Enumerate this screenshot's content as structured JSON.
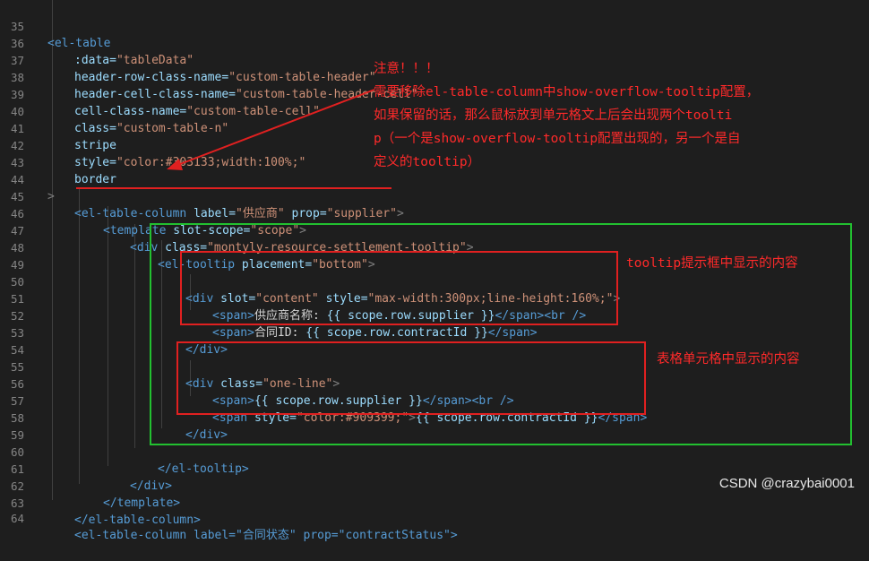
{
  "lines": [
    {
      "n": "35"
    },
    {
      "n": "36"
    },
    {
      "n": "37"
    },
    {
      "n": "38"
    },
    {
      "n": "39"
    },
    {
      "n": "40"
    },
    {
      "n": "41"
    },
    {
      "n": "42"
    },
    {
      "n": "43"
    },
    {
      "n": "44"
    },
    {
      "n": "45"
    },
    {
      "n": "46"
    },
    {
      "n": "47"
    },
    {
      "n": "48"
    },
    {
      "n": "49"
    },
    {
      "n": "50"
    },
    {
      "n": "51"
    },
    {
      "n": "52"
    },
    {
      "n": "53"
    },
    {
      "n": "54"
    },
    {
      "n": "55"
    },
    {
      "n": "56"
    },
    {
      "n": "57"
    },
    {
      "n": "58"
    },
    {
      "n": "59"
    },
    {
      "n": "60"
    },
    {
      "n": "61"
    },
    {
      "n": "62"
    },
    {
      "n": "63"
    },
    {
      "n": "64"
    }
  ],
  "code": {
    "l35_tag": "<el-table",
    "l36_attr": ":data=",
    "l36_val": "\"tableData\"",
    "l37_attr": "header-row-class-name=",
    "l37_val": "\"custom-table-header\"",
    "l38_attr": "header-cell-class-name=",
    "l38_val": "\"custom-table-header-cell\"",
    "l39_attr": "cell-class-name=",
    "l39_val": "\"custom-table-cell\"",
    "l40_attr": "class=",
    "l40_val": "\"custom-table-n\"",
    "l41_attr": "stripe",
    "l42_attr": "style=",
    "l42_val": "\"color:#303133;width:100%;\"",
    "l43_attr": "border",
    "l44_fold": ">",
    "l45_tag": "<el-table-column",
    "l45_attr1": "label=",
    "l45_val1": "\"供应商\"",
    "l45_attr2": "prop=",
    "l45_val2": "\"supplier\"",
    "l45_close": ">",
    "l46_tag": "<template",
    "l46_attr": "slot-scope=",
    "l46_val": "\"scope\"",
    "l46_close": ">",
    "l47_tag": "<div",
    "l47_attr": "class=",
    "l47_val": "\"montyly-resource-settlement-tooltip\"",
    "l47_close": ">",
    "l48_tag": "<el-tooltip",
    "l48_attr": "placement=",
    "l48_val": "\"bottom\"",
    "l48_close": ">",
    "l50_tag": "<div",
    "l50_attr1": "slot=",
    "l50_val1": "\"content\"",
    "l50_attr2": "style=",
    "l50_val2": "\"max-width:300px;line-height:160%;\"",
    "l50_close": ">",
    "l51_open": "<span>",
    "l51_text": "供应商名称: ",
    "l51_expr": "{{ scope.row.supplier }}",
    "l51_close": "</span><br />",
    "l52_open": "<span>",
    "l52_text": "合同ID: ",
    "l52_expr": "{{ scope.row.contractId }}",
    "l52_close": "</span>",
    "l53_tag": "</div>",
    "l55_tag": "<div",
    "l55_attr": "class=",
    "l55_val": "\"one-line\"",
    "l55_close": ">",
    "l56_open": "<span>",
    "l56_expr": "{{ scope.row.supplier }}",
    "l56_close": "</span><br />",
    "l57_open": "<span",
    "l57_attr": "style=",
    "l57_val": "\"color:#909399;\"",
    "l57_gt": ">",
    "l57_expr": "{{ scope.row.contractId }}",
    "l57_close": "</span>",
    "l58_tag": "</div>",
    "l60_tag": "</el-tooltip>",
    "l61_tag": "</div>",
    "l62_tag": "</template>",
    "l63_tag": "</el-table-column>",
    "l64_partial": "<el-table-column label=\"合同状态\" prop=\"contractStatus\">"
  },
  "annotations": {
    "warning_text": "注意！！！\n需要移除el-table-column中show-overflow-tooltip配置，\n如果保留的话，那么鼠标放到单元格文上后会出现两个toolti\np（一个是show-overflow-tooltip配置出现的，另一个是自\n定义的tooltip）",
    "tooltip_label": "tooltip提示框中显示的内容",
    "cell_label": "表格单元格中显示的内容",
    "color_red": "#e02020",
    "color_green": "#22c030"
  },
  "watermark": "CSDN @crazybai0001"
}
